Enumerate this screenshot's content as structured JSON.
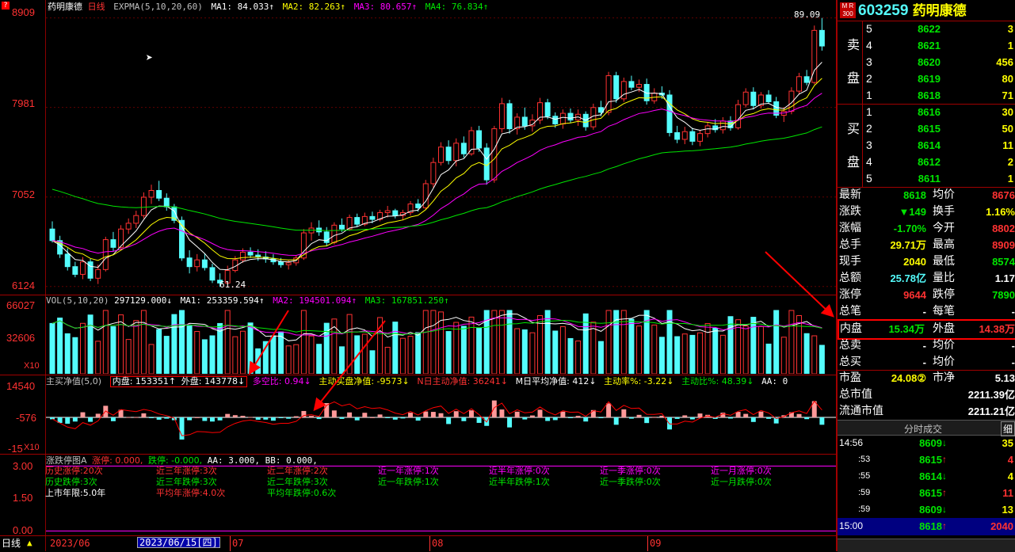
{
  "chart_header": {
    "stock_name": "药明康德",
    "period": "日线",
    "expma_label": "EXPMA(5,10,20,60)",
    "ma1": "MA1: 84.033↑",
    "ma2": "MA2: 82.263↑",
    "ma3": "MA3: 80.657↑",
    "ma4": "MA4: 76.834↑"
  },
  "price_axis": [
    "8909",
    "7981",
    "7052",
    "6124"
  ],
  "price_annotations": {
    "high": "89.09",
    "low": "61.24"
  },
  "vol_header": {
    "label": "VOL(5,10,20)",
    "value": "297129.000↓",
    "ma1": "MA1: 253359.594↑",
    "ma2": "MA2: 194501.094↑",
    "ma3": "MA3: 167851.250↑"
  },
  "vol_axis": [
    "66027",
    "32606",
    "X10"
  ],
  "net_axis": [
    "14540",
    "-576",
    "-15",
    "X10"
  ],
  "net_header": {
    "label": "主买净值(5,0)",
    "neipan": "内盘: 153351↑",
    "waipan": "外盘: 143778↓",
    "duokong": "多空比: 0.94↓",
    "zhudong": "主动买盘净值: -9573↓",
    "nri": "N日主动净值: 36241↓",
    "mri": "M日平均净值: 412↓",
    "rate": "主动率%: -3.22↓",
    "ratio": "主动比%: 48.39↓",
    "aa": "AA: 0"
  },
  "limit_axis": [
    "3.00",
    "1.50",
    "0.00"
  ],
  "limit_header": {
    "label": "涨跌停图A",
    "zt": "涨停: 0.000,",
    "dt": "跌停: -0.000,",
    "aa": "AA: 3.000,",
    "bb": "BB: 0.000,"
  },
  "limit_rows": [
    [
      "历史涨停:20次",
      "近三年涨停:3次",
      "近二年涨停:2次",
      "近一年涨停:1次",
      "近半年涨停:0次",
      "近一季涨停:0次",
      "近一月涨停:0次"
    ],
    [
      "历史跌停:3次",
      "近三年跌停:3次",
      "近二年跌停:3次",
      "近一年跌停:1次",
      "近半年跌停:1次",
      "近一季跌停:0次",
      "近一月跌停:0次"
    ],
    [
      "上市年限:5.0年",
      "平均年涨停:4.0次",
      "平均年跌停:0.6次"
    ]
  ],
  "date_axis": {
    "mode": "日线",
    "d1": "2023/06",
    "cursor": "2023/06/15[四]",
    "d2": "07",
    "d3": "08",
    "d4": "09"
  },
  "quote": {
    "code": "603259",
    "name": "药明康德",
    "badge_top": "M R",
    "badge_bottom": "300",
    "sell_label": [
      "卖",
      "盘"
    ],
    "buy_label": [
      "买",
      "盘"
    ],
    "sell": [
      {
        "lvl": "5",
        "price": "8622",
        "vol": "3"
      },
      {
        "lvl": "4",
        "price": "8621",
        "vol": "1"
      },
      {
        "lvl": "3",
        "price": "8620",
        "vol": "456"
      },
      {
        "lvl": "2",
        "price": "8619",
        "vol": "80"
      },
      {
        "lvl": "1",
        "price": "8618",
        "vol": "71"
      }
    ],
    "buy": [
      {
        "lvl": "1",
        "price": "8616",
        "vol": "30"
      },
      {
        "lvl": "2",
        "price": "8615",
        "vol": "50"
      },
      {
        "lvl": "3",
        "price": "8614",
        "vol": "11"
      },
      {
        "lvl": "4",
        "price": "8612",
        "vol": "2"
      },
      {
        "lvl": "5",
        "price": "8611",
        "vol": "1"
      }
    ],
    "stats": [
      {
        "l1": "最新",
        "v1": "8618",
        "l2": "均价",
        "v2": "8676"
      },
      {
        "l1": "涨跌",
        "v1": "▼149",
        "l2": "换手",
        "v2": "1.16%"
      },
      {
        "l1": "涨幅",
        "v1": "-1.70%",
        "l2": "今开",
        "v2": "8802"
      },
      {
        "l1": "总手",
        "v1": "29.71万",
        "l2": "最高",
        "v2": "8909"
      },
      {
        "l1": "现手",
        "v1": "2040",
        "l2": "最低",
        "v2": "8574"
      },
      {
        "l1": "总额",
        "v1": "25.78亿",
        "l2": "量比",
        "v2": "1.17"
      },
      {
        "l1": "涨停",
        "v1": "9644",
        "l2": "跌停",
        "v2": "7890"
      },
      {
        "l1": "总笔",
        "v1": "-",
        "l2": "每笔",
        "v2": "-"
      }
    ],
    "inout": {
      "l1": "内盘",
      "v1": "15.34万",
      "l2": "外盘",
      "v2": "14.38万"
    },
    "extra": [
      {
        "l1": "总卖",
        "v1": "-",
        "l2": "均价",
        "v2": "-"
      },
      {
        "l1": "总买",
        "v1": "-",
        "l2": "均价",
        "v2": "-"
      }
    ],
    "valuation": [
      {
        "l1": "市盈",
        "v1": "24.08②",
        "l2": "市净",
        "v2": "5.13"
      },
      {
        "l1": "总市值",
        "v1": "2211.39亿"
      },
      {
        "l1": "流通市值",
        "v1": "2211.21亿"
      }
    ]
  },
  "ticks": {
    "title": "分时成交",
    "detail": "细",
    "rows": [
      {
        "time": "14:56",
        "price": "8609",
        "dir": "↓",
        "vol": "35"
      },
      {
        "time": ":53",
        "price": "8615",
        "dir": "↑",
        "vol": "4"
      },
      {
        "time": ":55",
        "price": "8614",
        "dir": "↓",
        "vol": "4"
      },
      {
        "time": ":59",
        "price": "8615",
        "dir": "↑",
        "vol": "11"
      },
      {
        "time": ":59",
        "price": "8609",
        "dir": "↓",
        "vol": "13"
      }
    ],
    "final": {
      "time": "15:00",
      "price": "8618",
      "dir": "↑",
      "vol": "2040"
    }
  },
  "chart_data": {
    "type": "candlestick",
    "candles": [
      [
        67.2,
        68.0,
        65.8,
        66.0
      ],
      [
        66.0,
        66.5,
        64.2,
        64.6
      ],
      [
        64.6,
        65.2,
        62.9,
        63.3
      ],
      [
        63.3,
        63.8,
        62.2,
        62.5
      ],
      [
        62.5,
        64.3,
        62.0,
        63.8
      ],
      [
        63.8,
        64.1,
        61.8,
        62.1
      ],
      [
        62.1,
        63.5,
        61.5,
        63.0
      ],
      [
        63.0,
        66.4,
        62.8,
        66.1
      ],
      [
        66.1,
        66.9,
        64.9,
        65.3
      ],
      [
        65.3,
        67.6,
        65.0,
        67.2
      ],
      [
        67.2,
        68.3,
        66.7,
        67.8
      ],
      [
        67.8,
        69.1,
        67.3,
        68.6
      ],
      [
        68.6,
        71.0,
        68.3,
        70.5
      ],
      [
        70.5,
        71.8,
        69.8,
        71.2
      ],
      [
        71.2,
        72.2,
        70.1,
        70.4
      ],
      [
        70.4,
        70.9,
        69.1,
        69.5
      ],
      [
        69.5,
        69.8,
        67.8,
        68.1
      ],
      [
        68.1,
        68.5,
        63.9,
        64.2
      ],
      [
        64.2,
        65.0,
        62.6,
        63.3
      ],
      [
        63.3,
        64.6,
        62.8,
        64.0
      ],
      [
        64.0,
        64.7,
        62.9,
        63.2
      ],
      [
        63.2,
        63.6,
        61.6,
        61.9
      ],
      [
        61.9,
        62.6,
        61.2,
        61.6
      ],
      [
        61.6,
        63.4,
        61.4,
        62.9
      ],
      [
        62.9,
        64.4,
        62.7,
        64.0
      ],
      [
        64.0,
        65.2,
        63.7,
        64.8
      ],
      [
        64.8,
        65.3,
        64.2,
        64.5
      ],
      [
        64.5,
        65.1,
        63.9,
        64.3
      ],
      [
        64.3,
        64.9,
        63.7,
        64.1
      ],
      [
        64.1,
        64.6,
        63.5,
        63.8
      ],
      [
        63.8,
        64.2,
        63.2,
        63.5
      ],
      [
        63.5,
        64.0,
        63.0,
        63.7
      ],
      [
        63.7,
        64.5,
        63.4,
        64.2
      ],
      [
        64.2,
        67.2,
        64.0,
        66.8
      ],
      [
        66.8,
        67.9,
        66.0,
        67.3
      ],
      [
        67.3,
        68.1,
        66.5,
        66.9
      ],
      [
        66.9,
        67.4,
        65.4,
        65.8
      ],
      [
        65.8,
        67.9,
        65.6,
        67.6
      ],
      [
        67.6,
        68.3,
        66.9,
        67.2
      ],
      [
        67.2,
        68.7,
        67.0,
        68.4
      ],
      [
        68.4,
        68.8,
        67.4,
        67.7
      ],
      [
        67.7,
        68.9,
        67.5,
        68.5
      ],
      [
        68.5,
        69.0,
        67.8,
        68.2
      ],
      [
        68.2,
        69.2,
        68.0,
        68.9
      ],
      [
        68.9,
        69.6,
        68.4,
        69.1
      ],
      [
        69.1,
        69.3,
        68.3,
        68.6
      ],
      [
        68.6,
        69.2,
        68.1,
        68.9
      ],
      [
        68.9,
        70.1,
        68.6,
        69.8
      ],
      [
        69.8,
        70.3,
        69.0,
        69.4
      ],
      [
        69.4,
        72.3,
        69.2,
        71.9
      ],
      [
        71.9,
        74.6,
        71.5,
        74.1
      ],
      [
        74.1,
        76.2,
        73.8,
        75.7
      ],
      [
        75.7,
        76.4,
        73.9,
        74.3
      ],
      [
        74.3,
        76.6,
        73.7,
        76.1
      ],
      [
        76.1,
        76.8,
        74.6,
        75.0
      ],
      [
        75.0,
        77.8,
        74.8,
        77.4
      ],
      [
        77.4,
        77.9,
        75.2,
        75.6
      ],
      [
        75.6,
        76.1,
        71.8,
        72.3
      ],
      [
        72.3,
        77.9,
        72.0,
        77.6
      ],
      [
        77.6,
        80.8,
        77.2,
        80.2
      ],
      [
        80.2,
        80.6,
        77.1,
        77.6
      ],
      [
        77.6,
        79.2,
        77.0,
        78.8
      ],
      [
        78.8,
        79.8,
        77.5,
        77.9
      ],
      [
        77.9,
        79.1,
        77.3,
        78.5
      ],
      [
        78.5,
        80.8,
        78.1,
        80.3
      ],
      [
        80.3,
        80.7,
        78.6,
        78.9
      ],
      [
        78.9,
        79.3,
        77.7,
        78.1
      ],
      [
        78.1,
        79.6,
        77.6,
        79.2
      ],
      [
        79.2,
        79.7,
        78.2,
        78.5
      ],
      [
        78.5,
        79.6,
        77.9,
        79.1
      ],
      [
        79.1,
        79.4,
        77.4,
        77.8
      ],
      [
        77.8,
        80.2,
        77.5,
        79.8
      ],
      [
        79.8,
        80.5,
        78.9,
        79.3
      ],
      [
        79.3,
        83.5,
        79.0,
        83.1
      ],
      [
        83.1,
        83.5,
        80.3,
        80.7
      ],
      [
        80.7,
        82.9,
        80.4,
        82.5
      ],
      [
        82.5,
        83.1,
        81.6,
        81.9
      ],
      [
        81.9,
        82.7,
        81.4,
        82.2
      ],
      [
        82.2,
        82.8,
        80.1,
        80.5
      ],
      [
        80.5,
        81.8,
        80.2,
        81.3
      ],
      [
        81.3,
        82.0,
        80.7,
        81.1
      ],
      [
        81.1,
        81.6,
        76.8,
        77.2
      ],
      [
        77.2,
        77.9,
        76.1,
        76.5
      ],
      [
        76.5,
        77.8,
        76.0,
        77.3
      ],
      [
        77.3,
        77.7,
        75.9,
        76.3
      ],
      [
        76.3,
        77.4,
        75.8,
        77.1
      ],
      [
        77.1,
        78.3,
        76.7,
        77.9
      ],
      [
        77.9,
        78.6,
        77.2,
        77.5
      ],
      [
        77.5,
        78.8,
        77.1,
        78.4
      ],
      [
        78.4,
        78.9,
        77.4,
        77.7
      ],
      [
        77.7,
        80.6,
        77.5,
        80.1
      ],
      [
        80.1,
        81.8,
        79.8,
        81.4
      ],
      [
        81.4,
        81.9,
        79.6,
        80.0
      ],
      [
        80.0,
        81.4,
        79.7,
        81.1
      ],
      [
        81.1,
        81.6,
        80.2,
        80.4
      ],
      [
        80.4,
        80.9,
        78.7,
        79.0
      ],
      [
        79.0,
        79.8,
        78.3,
        79.4
      ],
      [
        79.4,
        81.9,
        79.1,
        81.5
      ],
      [
        81.5,
        83.4,
        81.2,
        83.0
      ],
      [
        83.0,
        83.7,
        82.1,
        82.4
      ],
      [
        82.4,
        88.3,
        82.2,
        87.8
      ],
      [
        87.8,
        89.09,
        85.7,
        86.18
      ]
    ],
    "ma_lines": [
      "MA1",
      "MA2",
      "MA3",
      "MA4"
    ],
    "y_ticks": [
      89.09,
      79.81,
      70.52,
      61.24
    ]
  }
}
